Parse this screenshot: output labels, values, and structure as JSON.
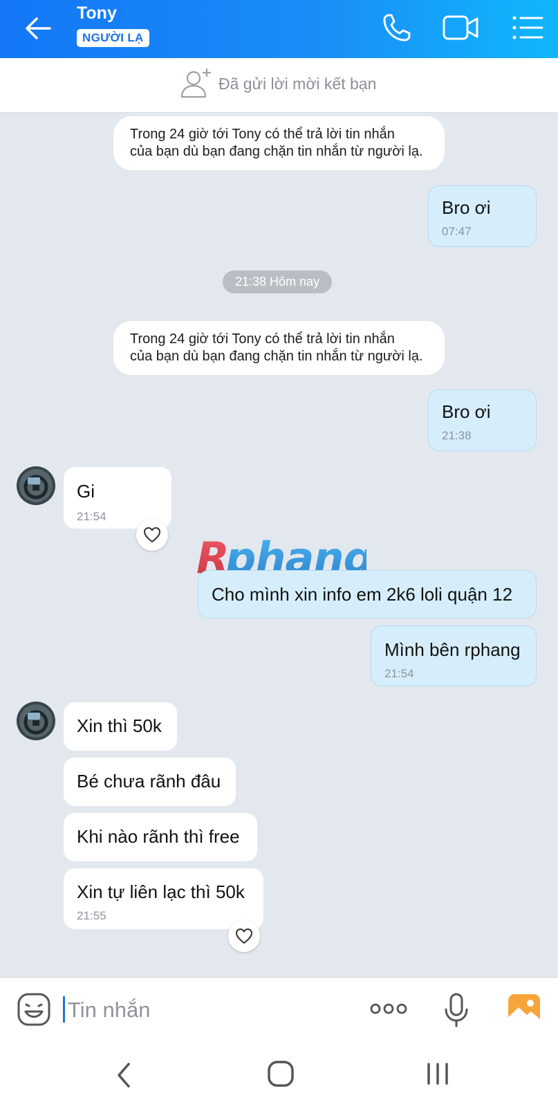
{
  "header": {
    "contact_name": "Tony",
    "badge": "NGƯỜI LẠ",
    "icons": [
      "back-arrow-icon",
      "phone-icon",
      "video-camera-icon",
      "menu-list-icon"
    ]
  },
  "friend_bar": {
    "text": "Đã gửi lời mời kết bạn",
    "icon": "add-friend-icon"
  },
  "notices": [
    {
      "line1": "Trong 24 giờ tới Tony có thể trả lời tin nhắn",
      "line2": "của bạn dù bạn đang chặn tin nhắn từ người lạ."
    },
    {
      "line1": "Trong 24 giờ tới Tony có thể trả lời tin nhắn",
      "line2": "của bạn dù bạn đang chặn tin nhắn từ người lạ."
    }
  ],
  "date_separator": "21:38 Hôm nay",
  "messages": [
    {
      "from": "me",
      "text": "Bro ơi",
      "time": "07:47"
    },
    {
      "from": "me",
      "text": "Bro ơi",
      "time": "21:38"
    },
    {
      "from": "them",
      "text": "Gi",
      "time": "21:54"
    },
    {
      "from": "me",
      "text": "Cho mình xin info em 2k6 loli quận 12",
      "time": ""
    },
    {
      "from": "me",
      "text": "Mình bên rphang",
      "time": "21:54"
    },
    {
      "from": "them",
      "text": "Xin thì 50k",
      "time": ""
    },
    {
      "from": "them",
      "text": "Bé chưa rãnh đâu",
      "time": ""
    },
    {
      "from": "them",
      "text": "Khi nào rãnh thì free",
      "time": ""
    },
    {
      "from": "them",
      "text": "Xin tự liên lạc thì 50k",
      "time": "21:55"
    }
  ],
  "watermark": "Rphang",
  "composer": {
    "placeholder": "Tin nhắn",
    "icons": [
      "emoji-icon",
      "more-options-icon",
      "microphone-icon",
      "gallery-icon"
    ]
  },
  "colors": {
    "header_start": "#1477f6",
    "header_end": "#10b6fb",
    "my_bubble": "#d6eefc",
    "their_bubble": "#ffffff",
    "background": "#e2e8ee",
    "accent": "#1a73e8"
  }
}
